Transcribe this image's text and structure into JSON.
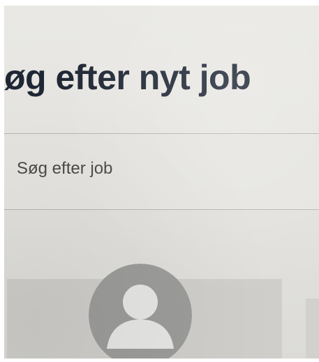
{
  "page": {
    "title": "øg efter nyt job"
  },
  "search": {
    "placeholder": "Søg efter job"
  },
  "profile": {
    "avatar_icon": "user-avatar-icon"
  },
  "colors": {
    "title": "#1f2735",
    "background": "#e7e6e2",
    "divider": "#b7b6b2",
    "avatar_bg": "#9c9c9a",
    "avatar_figure": "#e6e6e4"
  }
}
